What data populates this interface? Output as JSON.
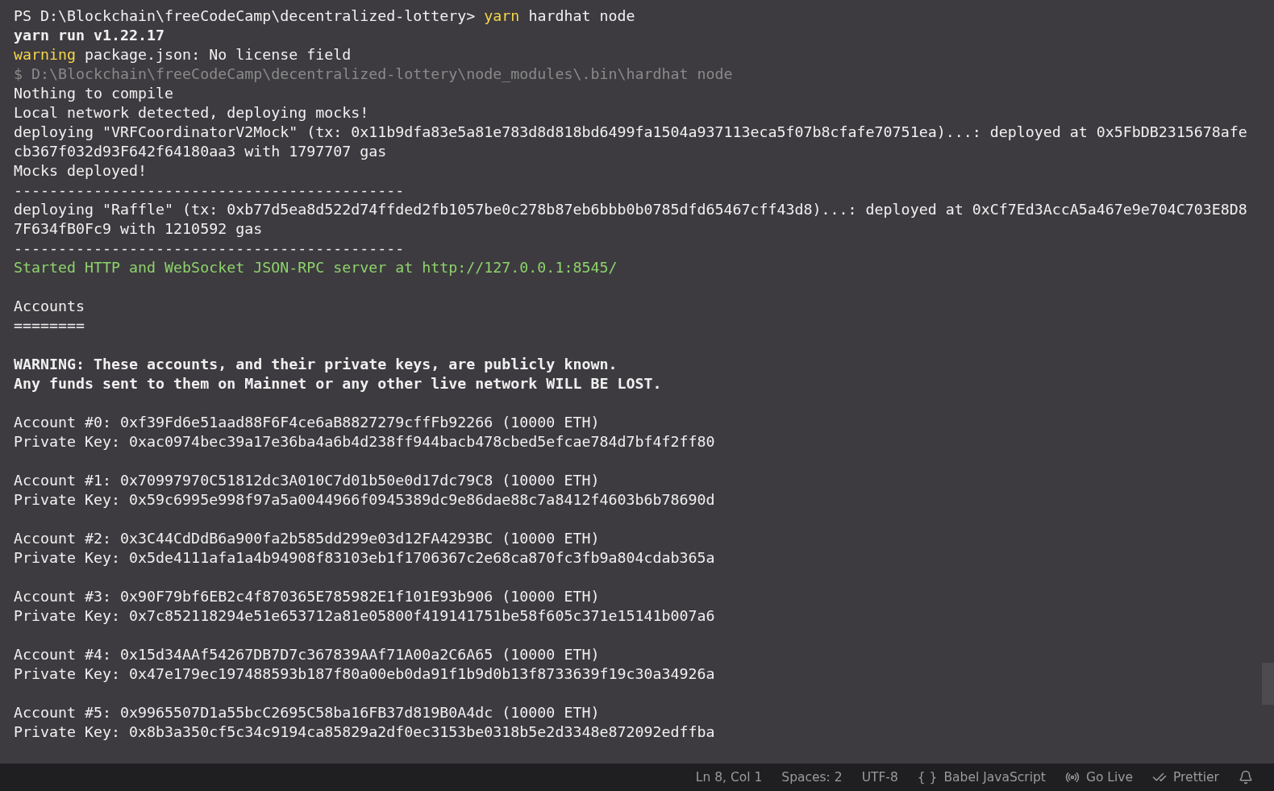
{
  "terminal": {
    "lines": [
      {
        "kind": "text",
        "segments": [
          {
            "text": "PS D:\\Blockchain\\freeCodeCamp\\decentralized-lottery> ",
            "color": "#f0f0f0",
            "bold": false
          },
          {
            "text": "yarn",
            "color": "#f5d54a",
            "bold": false
          },
          {
            "text": " hardhat node",
            "color": "#f0f0f0",
            "bold": false
          }
        ]
      },
      {
        "kind": "text",
        "segments": [
          {
            "text": "yarn run v1.22.17",
            "color": "#f0f0f0",
            "bold": true
          }
        ]
      },
      {
        "kind": "text",
        "segments": [
          {
            "text": "warning",
            "color": "#f5d54a",
            "bold": false
          },
          {
            "text": " package.json: No license field",
            "color": "#f0f0f0",
            "bold": false
          }
        ]
      },
      {
        "kind": "text",
        "segments": [
          {
            "text": "$ D:\\Blockchain\\freeCodeCamp\\decentralized-lottery\\node_modules\\.bin\\hardhat node",
            "color": "#8a8a8a",
            "bold": false
          }
        ]
      },
      {
        "kind": "text",
        "segments": [
          {
            "text": "Nothing to compile",
            "color": "#f0f0f0",
            "bold": false
          }
        ]
      },
      {
        "kind": "text",
        "segments": [
          {
            "text": "Local network detected, deploying mocks!",
            "color": "#f0f0f0",
            "bold": false
          }
        ]
      },
      {
        "kind": "text",
        "segments": [
          {
            "text": "deploying \"VRFCoordinatorV2Mock\" (tx: 0x11b9dfa83e5a81e783d8d818bd6499fa1504a937113eca5f07b8cfafe70751ea)...: deployed at 0x5FbDB2315678afe",
            "color": "#f0f0f0",
            "bold": false
          }
        ]
      },
      {
        "kind": "text",
        "segments": [
          {
            "text": "cb367f032d93F642f64180aa3 with 1797707 gas",
            "color": "#f0f0f0",
            "bold": false
          }
        ]
      },
      {
        "kind": "text",
        "segments": [
          {
            "text": "Mocks deployed!",
            "color": "#f0f0f0",
            "bold": false
          }
        ]
      },
      {
        "kind": "text",
        "segments": [
          {
            "text": "--------------------------------------------",
            "color": "#f0f0f0",
            "bold": false
          }
        ]
      },
      {
        "kind": "text",
        "segments": [
          {
            "text": "deploying \"Raffle\" (tx: 0xb77d5ea8d522d74ffded2fb1057be0c278b87eb6bbb0b0785dfd65467cff43d8)...: deployed at 0xCf7Ed3AccA5a467e9e704C703E8D8",
            "color": "#f0f0f0",
            "bold": false
          }
        ]
      },
      {
        "kind": "text",
        "segments": [
          {
            "text": "7F634fB0Fc9 with 1210592 gas",
            "color": "#f0f0f0",
            "bold": false
          }
        ]
      },
      {
        "kind": "text",
        "segments": [
          {
            "text": "--------------------------------------------",
            "color": "#f0f0f0",
            "bold": false
          }
        ]
      },
      {
        "kind": "text",
        "segments": [
          {
            "text": "Started HTTP and WebSocket JSON-RPC server at http://127.0.0.1:8545/",
            "color": "#8ed36b",
            "bold": false
          }
        ]
      },
      {
        "kind": "blank"
      },
      {
        "kind": "text",
        "segments": [
          {
            "text": "Accounts",
            "color": "#f0f0f0",
            "bold": false
          }
        ]
      },
      {
        "kind": "text",
        "segments": [
          {
            "text": "========",
            "color": "#f0f0f0",
            "bold": false
          }
        ]
      },
      {
        "kind": "blank"
      },
      {
        "kind": "text",
        "segments": [
          {
            "text": "WARNING: These accounts, and their private keys, are publicly known.",
            "color": "#f0f0f0",
            "bold": true
          }
        ]
      },
      {
        "kind": "text",
        "segments": [
          {
            "text": "Any funds sent to them on Mainnet or any other live network WILL BE LOST.",
            "color": "#f0f0f0",
            "bold": true
          }
        ]
      },
      {
        "kind": "blank"
      },
      {
        "kind": "text",
        "segments": [
          {
            "text": "Account #0: 0xf39Fd6e51aad88F6F4ce6aB8827279cffFb92266 (10000 ETH)",
            "color": "#f0f0f0",
            "bold": false
          }
        ]
      },
      {
        "kind": "text",
        "segments": [
          {
            "text": "Private Key: 0xac0974bec39a17e36ba4a6b4d238ff944bacb478cbed5efcae784d7bf4f2ff80",
            "color": "#f0f0f0",
            "bold": false
          }
        ]
      },
      {
        "kind": "blank"
      },
      {
        "kind": "text",
        "segments": [
          {
            "text": "Account #1: 0x70997970C51812dc3A010C7d01b50e0d17dc79C8 (10000 ETH)",
            "color": "#f0f0f0",
            "bold": false
          }
        ]
      },
      {
        "kind": "text",
        "segments": [
          {
            "text": "Private Key: 0x59c6995e998f97a5a0044966f0945389dc9e86dae88c7a8412f4603b6b78690d",
            "color": "#f0f0f0",
            "bold": false
          }
        ]
      },
      {
        "kind": "blank"
      },
      {
        "kind": "text",
        "segments": [
          {
            "text": "Account #2: 0x3C44CdDdB6a900fa2b585dd299e03d12FA4293BC (10000 ETH)",
            "color": "#f0f0f0",
            "bold": false
          }
        ]
      },
      {
        "kind": "text",
        "segments": [
          {
            "text": "Private Key: 0x5de4111afa1a4b94908f83103eb1f1706367c2e68ca870fc3fb9a804cdab365a",
            "color": "#f0f0f0",
            "bold": false
          }
        ]
      },
      {
        "kind": "blank"
      },
      {
        "kind": "text",
        "segments": [
          {
            "text": "Account #3: 0x90F79bf6EB2c4f870365E785982E1f101E93b906 (10000 ETH)",
            "color": "#f0f0f0",
            "bold": false
          }
        ]
      },
      {
        "kind": "text",
        "segments": [
          {
            "text": "Private Key: 0x7c852118294e51e653712a81e05800f419141751be58f605c371e15141b007a6",
            "color": "#f0f0f0",
            "bold": false
          }
        ]
      },
      {
        "kind": "blank"
      },
      {
        "kind": "text",
        "segments": [
          {
            "text": "Account #4: 0x15d34AAf54267DB7D7c367839AAf71A00a2C6A65 (10000 ETH)",
            "color": "#f0f0f0",
            "bold": false
          }
        ]
      },
      {
        "kind": "text",
        "segments": [
          {
            "text": "Private Key: 0x47e179ec197488593b187f80a00eb0da91f1b9d0b13f8733639f19c30a34926a",
            "color": "#f0f0f0",
            "bold": false
          }
        ]
      },
      {
        "kind": "blank"
      },
      {
        "kind": "text",
        "segments": [
          {
            "text": "Account #5: 0x9965507D1a55bcC2695C58ba16FB37d819B0A4dc (10000 ETH)",
            "color": "#f0f0f0",
            "bold": false
          }
        ]
      },
      {
        "kind": "text",
        "segments": [
          {
            "text": "Private Key: 0x8b3a350cf5c34c9194ca85829a2df0ec3153be0318b5e2d3348e872092edffba",
            "color": "#f0f0f0",
            "bold": false
          }
        ]
      }
    ]
  },
  "status_bar": {
    "items": [
      {
        "kind": "text",
        "label": "Ln 8, Col 1"
      },
      {
        "kind": "text",
        "label": "Spaces: 2"
      },
      {
        "kind": "text",
        "label": "UTF-8"
      },
      {
        "kind": "glyph",
        "glyph": "{ }",
        "label": "Babel JavaScript"
      },
      {
        "kind": "broadcast",
        "label": "Go Live"
      },
      {
        "kind": "checks",
        "label": "Prettier"
      },
      {
        "kind": "bell"
      }
    ]
  }
}
